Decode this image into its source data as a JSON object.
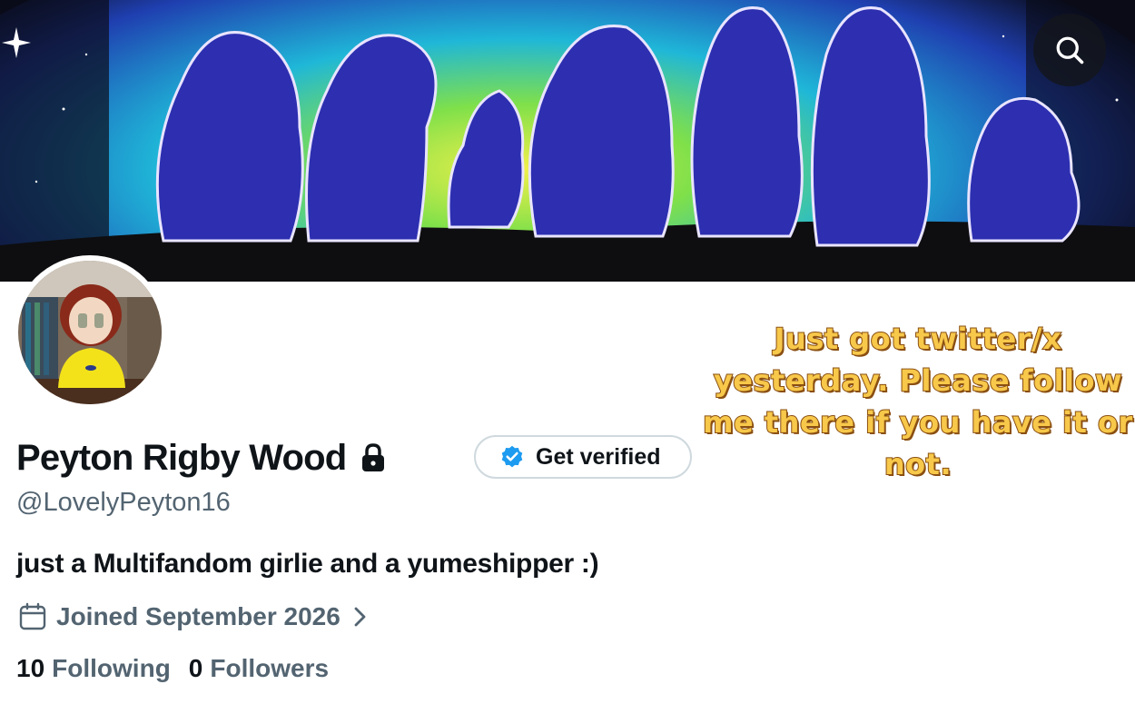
{
  "profile": {
    "display_name": "Peyton Rigby Wood",
    "handle": "@LovelyPeyton16",
    "bio": "just a Multifandom girlie and a yumeshipper :)",
    "joined": "Joined September 2026",
    "verify_label": "Get verified"
  },
  "stats": {
    "following_count": "10",
    "following_label": "Following",
    "followers_count": "0",
    "followers_label": "Followers"
  },
  "overlay": {
    "caption": "Just got twitter/x yesterday. Please follow me there if you have it or not."
  },
  "icons": {
    "search": "search-icon",
    "lock": "lock-icon",
    "verified": "verified-badge-icon",
    "calendar": "calendar-icon",
    "chevron": "chevron-right-icon"
  },
  "colors": {
    "text_primary": "#0f1419",
    "text_secondary": "#536471",
    "verified_blue": "#1d9bf0",
    "caption_fill": "#f7c84a",
    "caption_outline": "#8a4f12"
  }
}
